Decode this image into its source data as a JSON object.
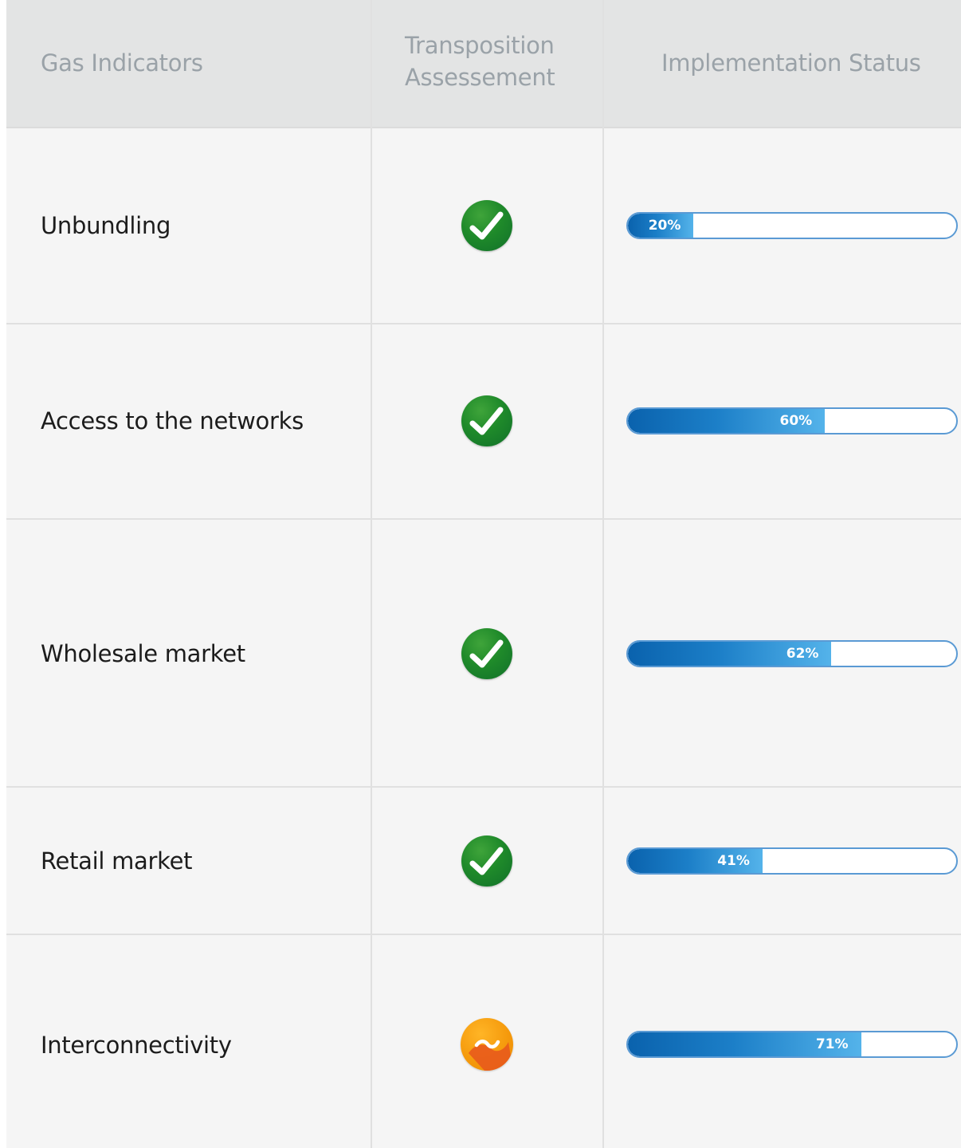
{
  "header": {
    "col1": "Gas Indicators",
    "col2_line1": "Transposition",
    "col2_line2": "Assessement",
    "col3": "Implementation Status"
  },
  "rows": [
    {
      "label": "Unbundling",
      "assessment": "check-icon",
      "progress": 20,
      "progress_label": "20%"
    },
    {
      "label": "Access to the networks",
      "assessment": "check-icon",
      "progress": 60,
      "progress_label": "60%"
    },
    {
      "label": "Wholesale market",
      "assessment": "check-icon",
      "progress": 62,
      "progress_label": "62%"
    },
    {
      "label": "Retail market",
      "assessment": "check-icon",
      "progress": 41,
      "progress_label": "41%"
    },
    {
      "label": "Interconnectivity",
      "assessment": "tilde-icon",
      "progress": 71,
      "progress_label": "71%"
    }
  ],
  "colors": {
    "header_bg": "#e3e4e4",
    "row_bg": "#f5f5f5",
    "check_green": "#1f8a2a",
    "partial_orange": "#f59a0c",
    "bar_blue": "#0a62ad",
    "bar_border": "#5a9ad4"
  }
}
